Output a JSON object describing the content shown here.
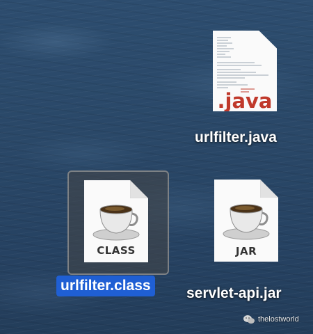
{
  "desktop": {
    "icons": [
      {
        "name": "urlfilter.java",
        "type_badge": ".java",
        "selected": false
      },
      {
        "name": "urlfilter.class",
        "type_badge": "CLASS",
        "selected": true
      },
      {
        "name": "servlet-api.jar",
        "type_badge": "JAR",
        "selected": false
      }
    ]
  },
  "watermark": {
    "text": "thelostworld",
    "icon": "wechat-icon"
  },
  "colors": {
    "selection_label_bg": "#1f5fd4",
    "java_badge": "#c0392b"
  }
}
